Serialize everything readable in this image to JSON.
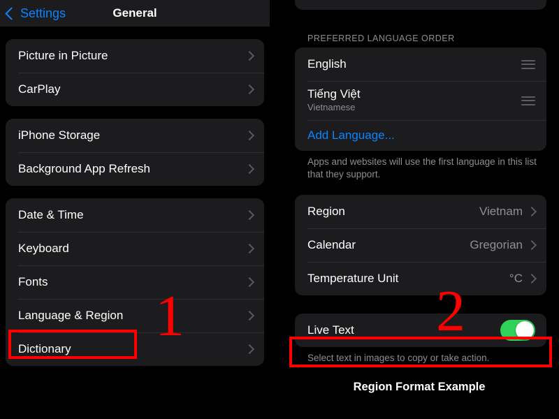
{
  "colors": {
    "background": "#000000",
    "card": "#1c1c1e",
    "accent_blue": "#0a84ff",
    "toggle_green": "#30d158",
    "secondary_text": "#8e8e93",
    "annotation_red": "#ff0000"
  },
  "left_panel": {
    "navbar": {
      "back_label": "Settings",
      "title": "General",
      "back_icon": "chevron-left-icon"
    },
    "groups": [
      {
        "rows": [
          {
            "label": "Picture in Picture",
            "accessory": "chevron-right-icon"
          },
          {
            "label": "CarPlay",
            "accessory": "chevron-right-icon"
          }
        ]
      },
      {
        "rows": [
          {
            "label": "iPhone Storage",
            "accessory": "chevron-right-icon"
          },
          {
            "label": "Background App Refresh",
            "accessory": "chevron-right-icon"
          }
        ]
      },
      {
        "rows": [
          {
            "label": "Date & Time",
            "accessory": "chevron-right-icon"
          },
          {
            "label": "Keyboard",
            "accessory": "chevron-right-icon"
          },
          {
            "label": "Fonts",
            "accessory": "chevron-right-icon"
          },
          {
            "label": "Language & Region",
            "accessory": "chevron-right-icon"
          },
          {
            "label": "Dictionary",
            "accessory": "chevron-right-icon"
          }
        ]
      }
    ]
  },
  "right_panel": {
    "section_header": "PREFERRED LANGUAGE ORDER",
    "languages": [
      {
        "native": "English",
        "english": "",
        "accessory": "drag-handle-icon"
      },
      {
        "native": "Tiếng Việt",
        "english": "Vietnamese",
        "accessory": "drag-handle-icon"
      }
    ],
    "add_language_label": "Add Language...",
    "language_footnote": "Apps and websites will use the first language in this list that they support.",
    "region_rows": [
      {
        "label": "Region",
        "value": "Vietnam",
        "accessory": "chevron-right-icon"
      },
      {
        "label": "Calendar",
        "value": "Gregorian",
        "accessory": "chevron-right-icon"
      },
      {
        "label": "Temperature Unit",
        "value": "°C",
        "accessory": "chevron-right-icon"
      }
    ],
    "live_text": {
      "label": "Live Text",
      "state": "on",
      "footnote": "Select text in images to copy or take action."
    },
    "region_format_example_title": "Region Format Example"
  },
  "annotations": {
    "step_one": "1",
    "step_two": "2"
  }
}
